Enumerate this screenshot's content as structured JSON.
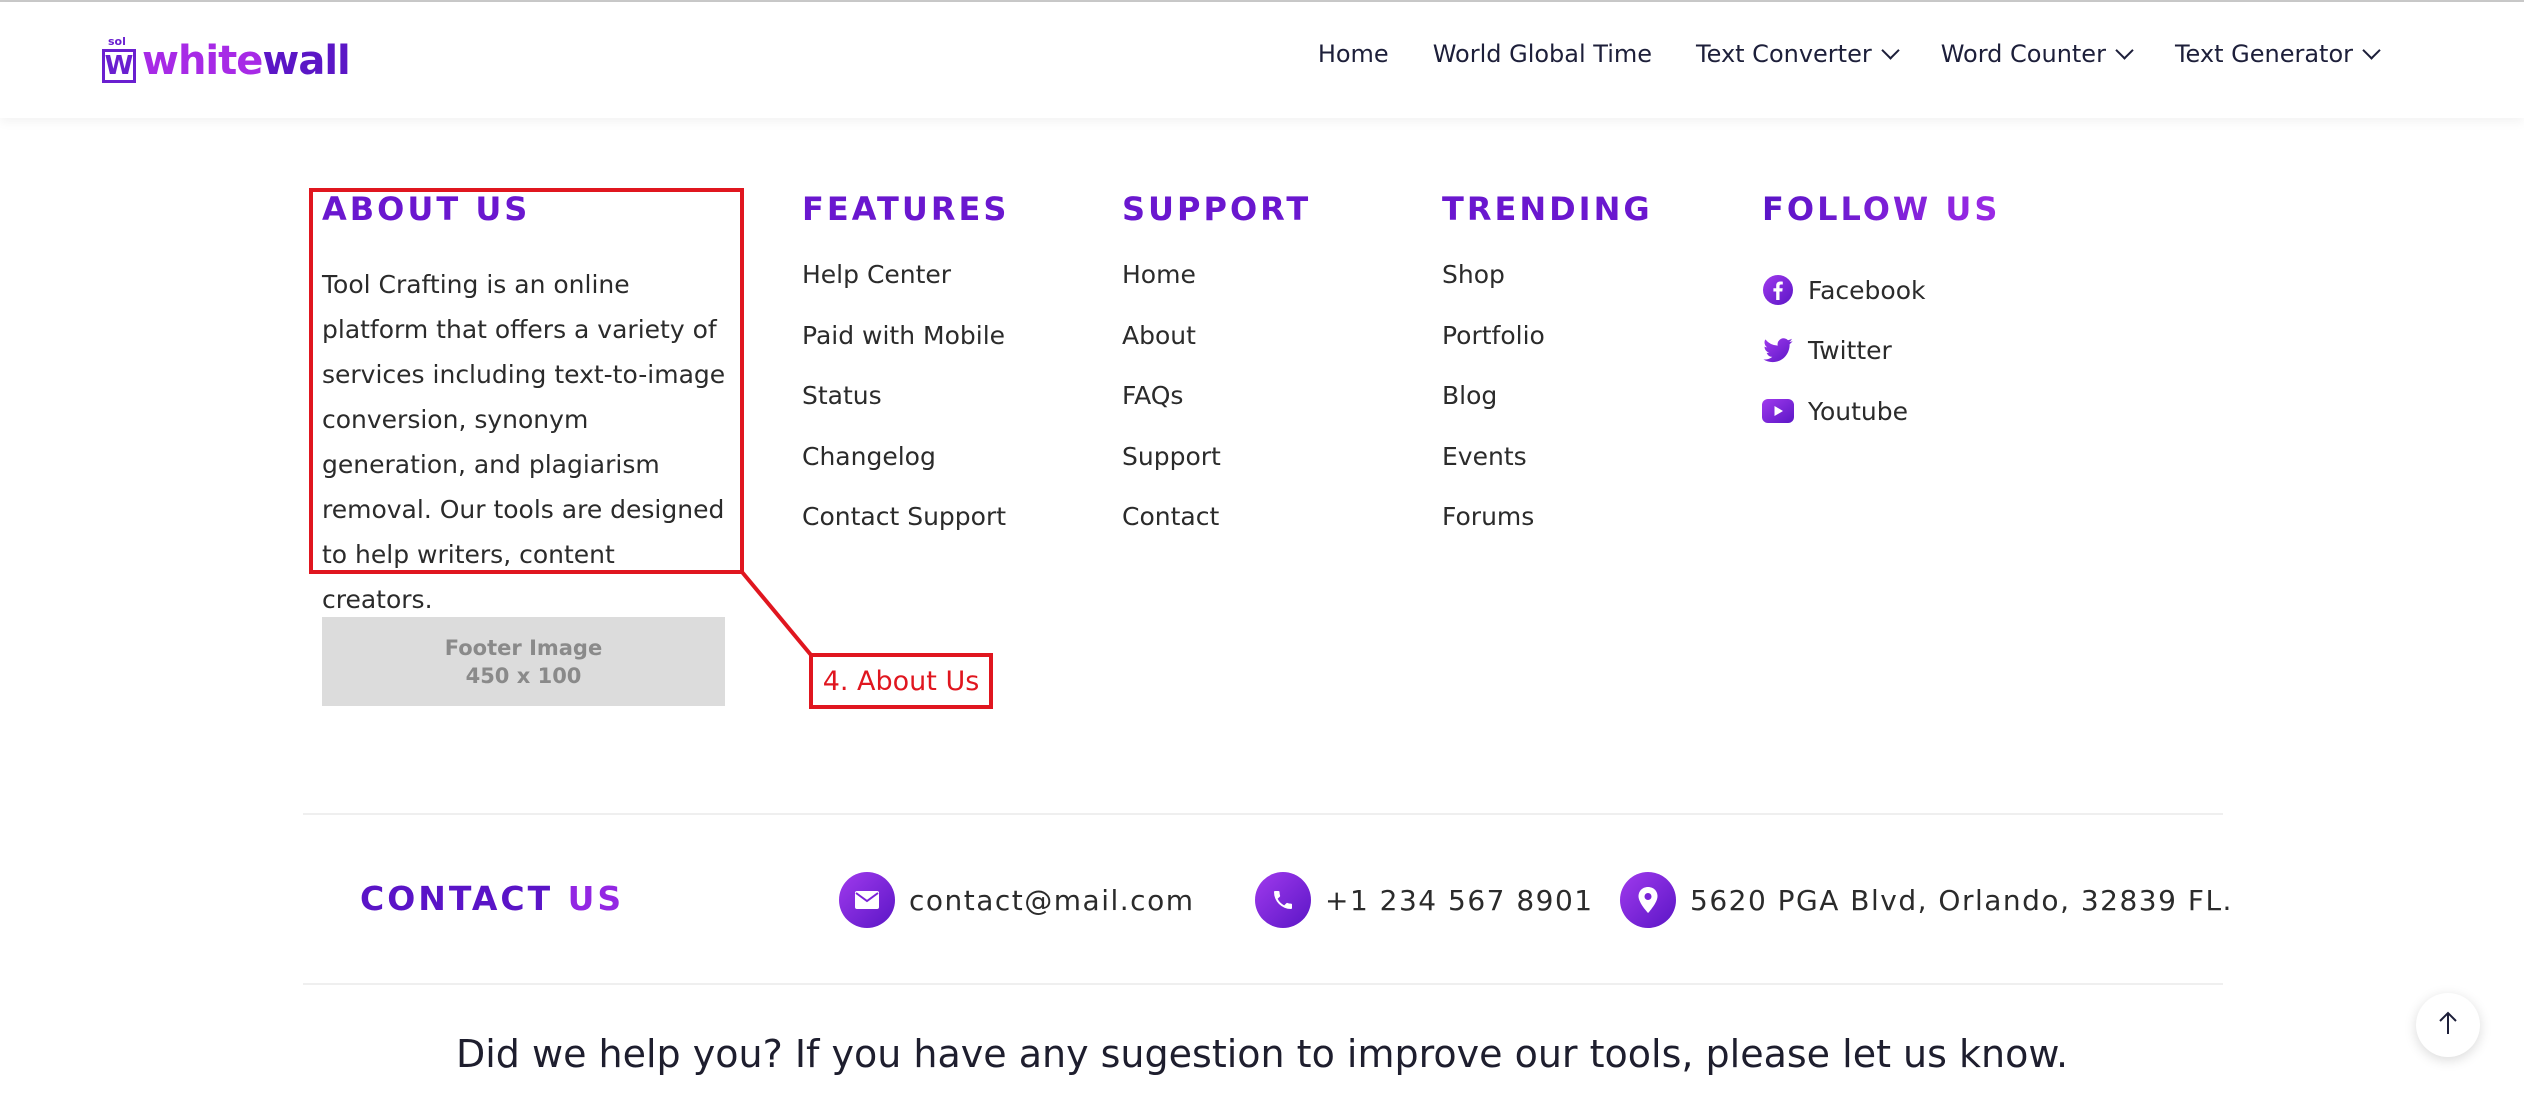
{
  "brand": {
    "small": "sol",
    "mark": "W",
    "name_part1": "white",
    "name_part2": "wall"
  },
  "nav": [
    {
      "label": "Home",
      "dropdown": false
    },
    {
      "label": "World Global Time",
      "dropdown": false
    },
    {
      "label": "Text Converter",
      "dropdown": true
    },
    {
      "label": "Word Counter",
      "dropdown": true
    },
    {
      "label": "Text Generator",
      "dropdown": true
    }
  ],
  "about": {
    "title": "ABOUT US",
    "text": "Tool Crafting is an online platform that offers a variety of services including text-to-image conversion, synonym generation, and plagiarism removal. Our tools are designed to help writers, content creators.",
    "image_line1": "Footer Image",
    "image_line2": "450 x 100"
  },
  "features": {
    "title": "FEATURES",
    "links": [
      "Help Center",
      "Paid with Mobile",
      "Status",
      "Changelog",
      "Contact Support"
    ]
  },
  "support": {
    "title": "SUPPORT",
    "links": [
      "Home",
      "About",
      "FAQs",
      "Support",
      "Contact"
    ]
  },
  "trending": {
    "title": "TRENDING",
    "links": [
      "Shop",
      "Portfolio",
      "Blog",
      "Events",
      "Forums"
    ]
  },
  "follow": {
    "title": "FOLLOW US",
    "links": [
      {
        "label": "Facebook",
        "icon": "facebook-icon"
      },
      {
        "label": "Twitter",
        "icon": "twitter-icon"
      },
      {
        "label": "Youtube",
        "icon": "youtube-icon"
      }
    ]
  },
  "annotation": {
    "label": "4. About Us",
    "color": "#e0161f"
  },
  "contact": {
    "title_part1": "CONTACT",
    "title_part2": "US",
    "email": "contact@mail.com",
    "phone": "+1 234 567 8901",
    "address": "5620 PGA Blvd, Orlando, 32839 FL."
  },
  "help_text": "Did we help you? If you have any sugestion to improve our tools, please let us know.",
  "colors": {
    "accent": "#6a17cf",
    "accent_light": "#a72ae6",
    "text": "#2b2b2b"
  }
}
